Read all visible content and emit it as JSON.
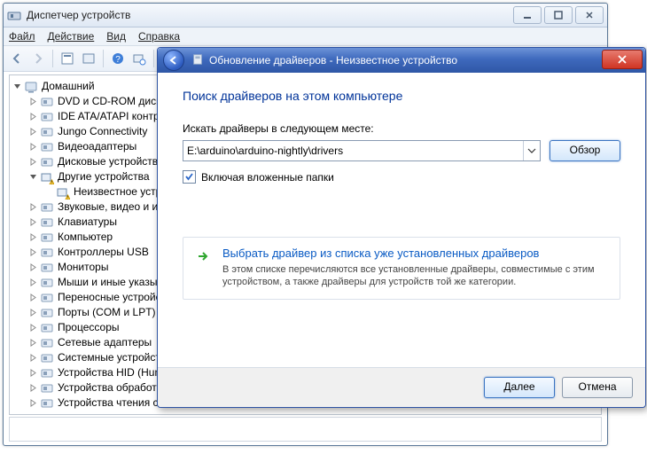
{
  "dm": {
    "title": "Диспетчер устройств",
    "menu": {
      "file": "Файл",
      "action": "Действие",
      "view": "Вид",
      "help": "Справка"
    },
    "root": "Домашний",
    "nodes": [
      {
        "label": "DVD и CD-ROM диско"
      },
      {
        "label": "IDE ATA/ATAPI контр"
      },
      {
        "label": "Jungo Connectivity"
      },
      {
        "label": "Видеоадаптеры"
      },
      {
        "label": "Дисковые устройств"
      },
      {
        "label": "Другие устройства",
        "open": true,
        "warn": true,
        "children": [
          {
            "label": "Неизвестное устро",
            "warn": true
          }
        ]
      },
      {
        "label": "Звуковые, видео и иг"
      },
      {
        "label": "Клавиатуры"
      },
      {
        "label": "Компьютер"
      },
      {
        "label": "Контроллеры USB"
      },
      {
        "label": "Мониторы"
      },
      {
        "label": "Мыши и иные указыв"
      },
      {
        "label": "Переносные устройс"
      },
      {
        "label": "Порты (COM и LPT)"
      },
      {
        "label": "Процессоры"
      },
      {
        "label": "Сетевые адаптеры"
      },
      {
        "label": "Системные устройст"
      },
      {
        "label": "Устройства HID (Hum"
      },
      {
        "label": "Устройства обработк"
      },
      {
        "label": "Устройства чтения см"
      }
    ]
  },
  "dlg": {
    "title": "Обновление драйверов - Неизвестное устройство",
    "heading": "Поиск драйверов на этом компьютере",
    "path_label": "Искать драйверы в следующем месте:",
    "path_value": "E:\\arduino\\arduino-nightly\\drivers",
    "browse": "Обзор",
    "include_sub": "Включая вложенные папки",
    "include_sub_checked": true,
    "option_title": "Выбрать драйвер из списка уже установленных драйверов",
    "option_desc": "В этом списке перечисляются все установленные драйверы, совместимые с этим устройством, а также драйверы для устройств той же категории.",
    "next": "Далее",
    "cancel": "Отмена"
  }
}
